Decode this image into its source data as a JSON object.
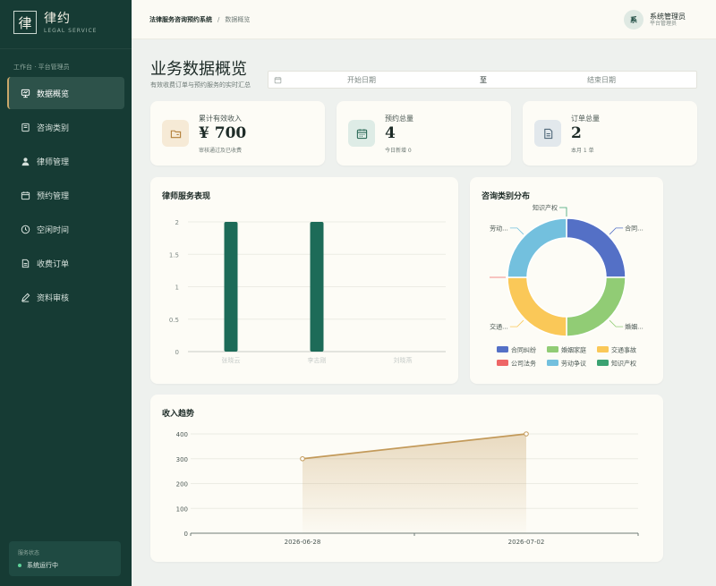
{
  "brand": {
    "mark": "律",
    "name": "律约",
    "sub": "LEGAL SERVICE"
  },
  "sidebar": {
    "caption": "工作台 · 平台管理员",
    "items": [
      {
        "label": "数据概览",
        "icon": "dashboard-icon",
        "active": true
      },
      {
        "label": "咨询类别",
        "icon": "book-icon"
      },
      {
        "label": "律师管理",
        "icon": "user-icon"
      },
      {
        "label": "预约管理",
        "icon": "calendar-icon"
      },
      {
        "label": "空闲时间",
        "icon": "clock-icon"
      },
      {
        "label": "收费订单",
        "icon": "document-icon"
      },
      {
        "label": "资料审核",
        "icon": "pen-icon"
      }
    ],
    "status_label": "服务状态",
    "status_text": "系统运行中"
  },
  "topbar": {
    "breadcrumb_root": "法律服务咨询预约系统",
    "breadcrumb_sep": "/",
    "breadcrumb_current": "数据概览",
    "avatar": "系",
    "user_name": "系统管理员",
    "user_role": "平台管理员"
  },
  "header": {
    "title": "业务数据概览",
    "subtitle": "有效收费订单与预约服务的实时汇总",
    "date_start_placeholder": "开始日期",
    "date_to": "至",
    "date_end_placeholder": "结束日期"
  },
  "stats": [
    {
      "label": "累计有效收入",
      "value": "¥ 700",
      "note": "审核通过及已收费",
      "icon": "folder-icon",
      "icon_bg": "#f6ead6",
      "icon_color": "#b3803a"
    },
    {
      "label": "预约总量",
      "value": "4",
      "note": "今日新增 0",
      "icon": "calendar-icon",
      "icon_bg": "#deece6",
      "icon_color": "#2f6c5a"
    },
    {
      "label": "订单总量",
      "value": "2",
      "note": "本月 1 单",
      "icon": "document-icon",
      "icon_bg": "#e2e8ec",
      "icon_color": "#51697a"
    }
  ],
  "colors": {
    "bar": "#1d6b58",
    "trend": "#c39a5a",
    "grid": "#ecece4",
    "axis": "#7d8884"
  },
  "chart_data": [
    {
      "type": "bar",
      "title": "律师服务表现",
      "categories": [
        "张晓云",
        "李志刚",
        "刘晓燕"
      ],
      "values": [
        2,
        2,
        0
      ],
      "ylim": [
        0,
        2
      ],
      "yticks": [
        "0",
        "0.5",
        "1",
        "1.5",
        "2"
      ]
    },
    {
      "type": "pie",
      "title": "咨询类别分布",
      "categories": [
        "合同纠纷",
        "婚姻家庭",
        "交通事故",
        "公司法务",
        "劳动争议",
        "知识产权"
      ],
      "values": [
        1,
        1,
        1,
        0,
        1,
        0
      ],
      "colors": [
        "#5470c6",
        "#91cc75",
        "#fac858",
        "#ee6666",
        "#73c0de",
        "#3ba272"
      ],
      "slice_labels": [
        "合同...",
        "婚姻...",
        "交通...",
        "",
        "劳动...",
        "知识产权"
      ]
    },
    {
      "type": "area",
      "title": "收入趋势",
      "x": [
        "2026-06-28",
        "2026-07-02"
      ],
      "values": [
        300,
        400
      ],
      "ylim": [
        0,
        400
      ],
      "yticks": [
        "0",
        "100",
        "200",
        "300",
        "400"
      ]
    }
  ]
}
